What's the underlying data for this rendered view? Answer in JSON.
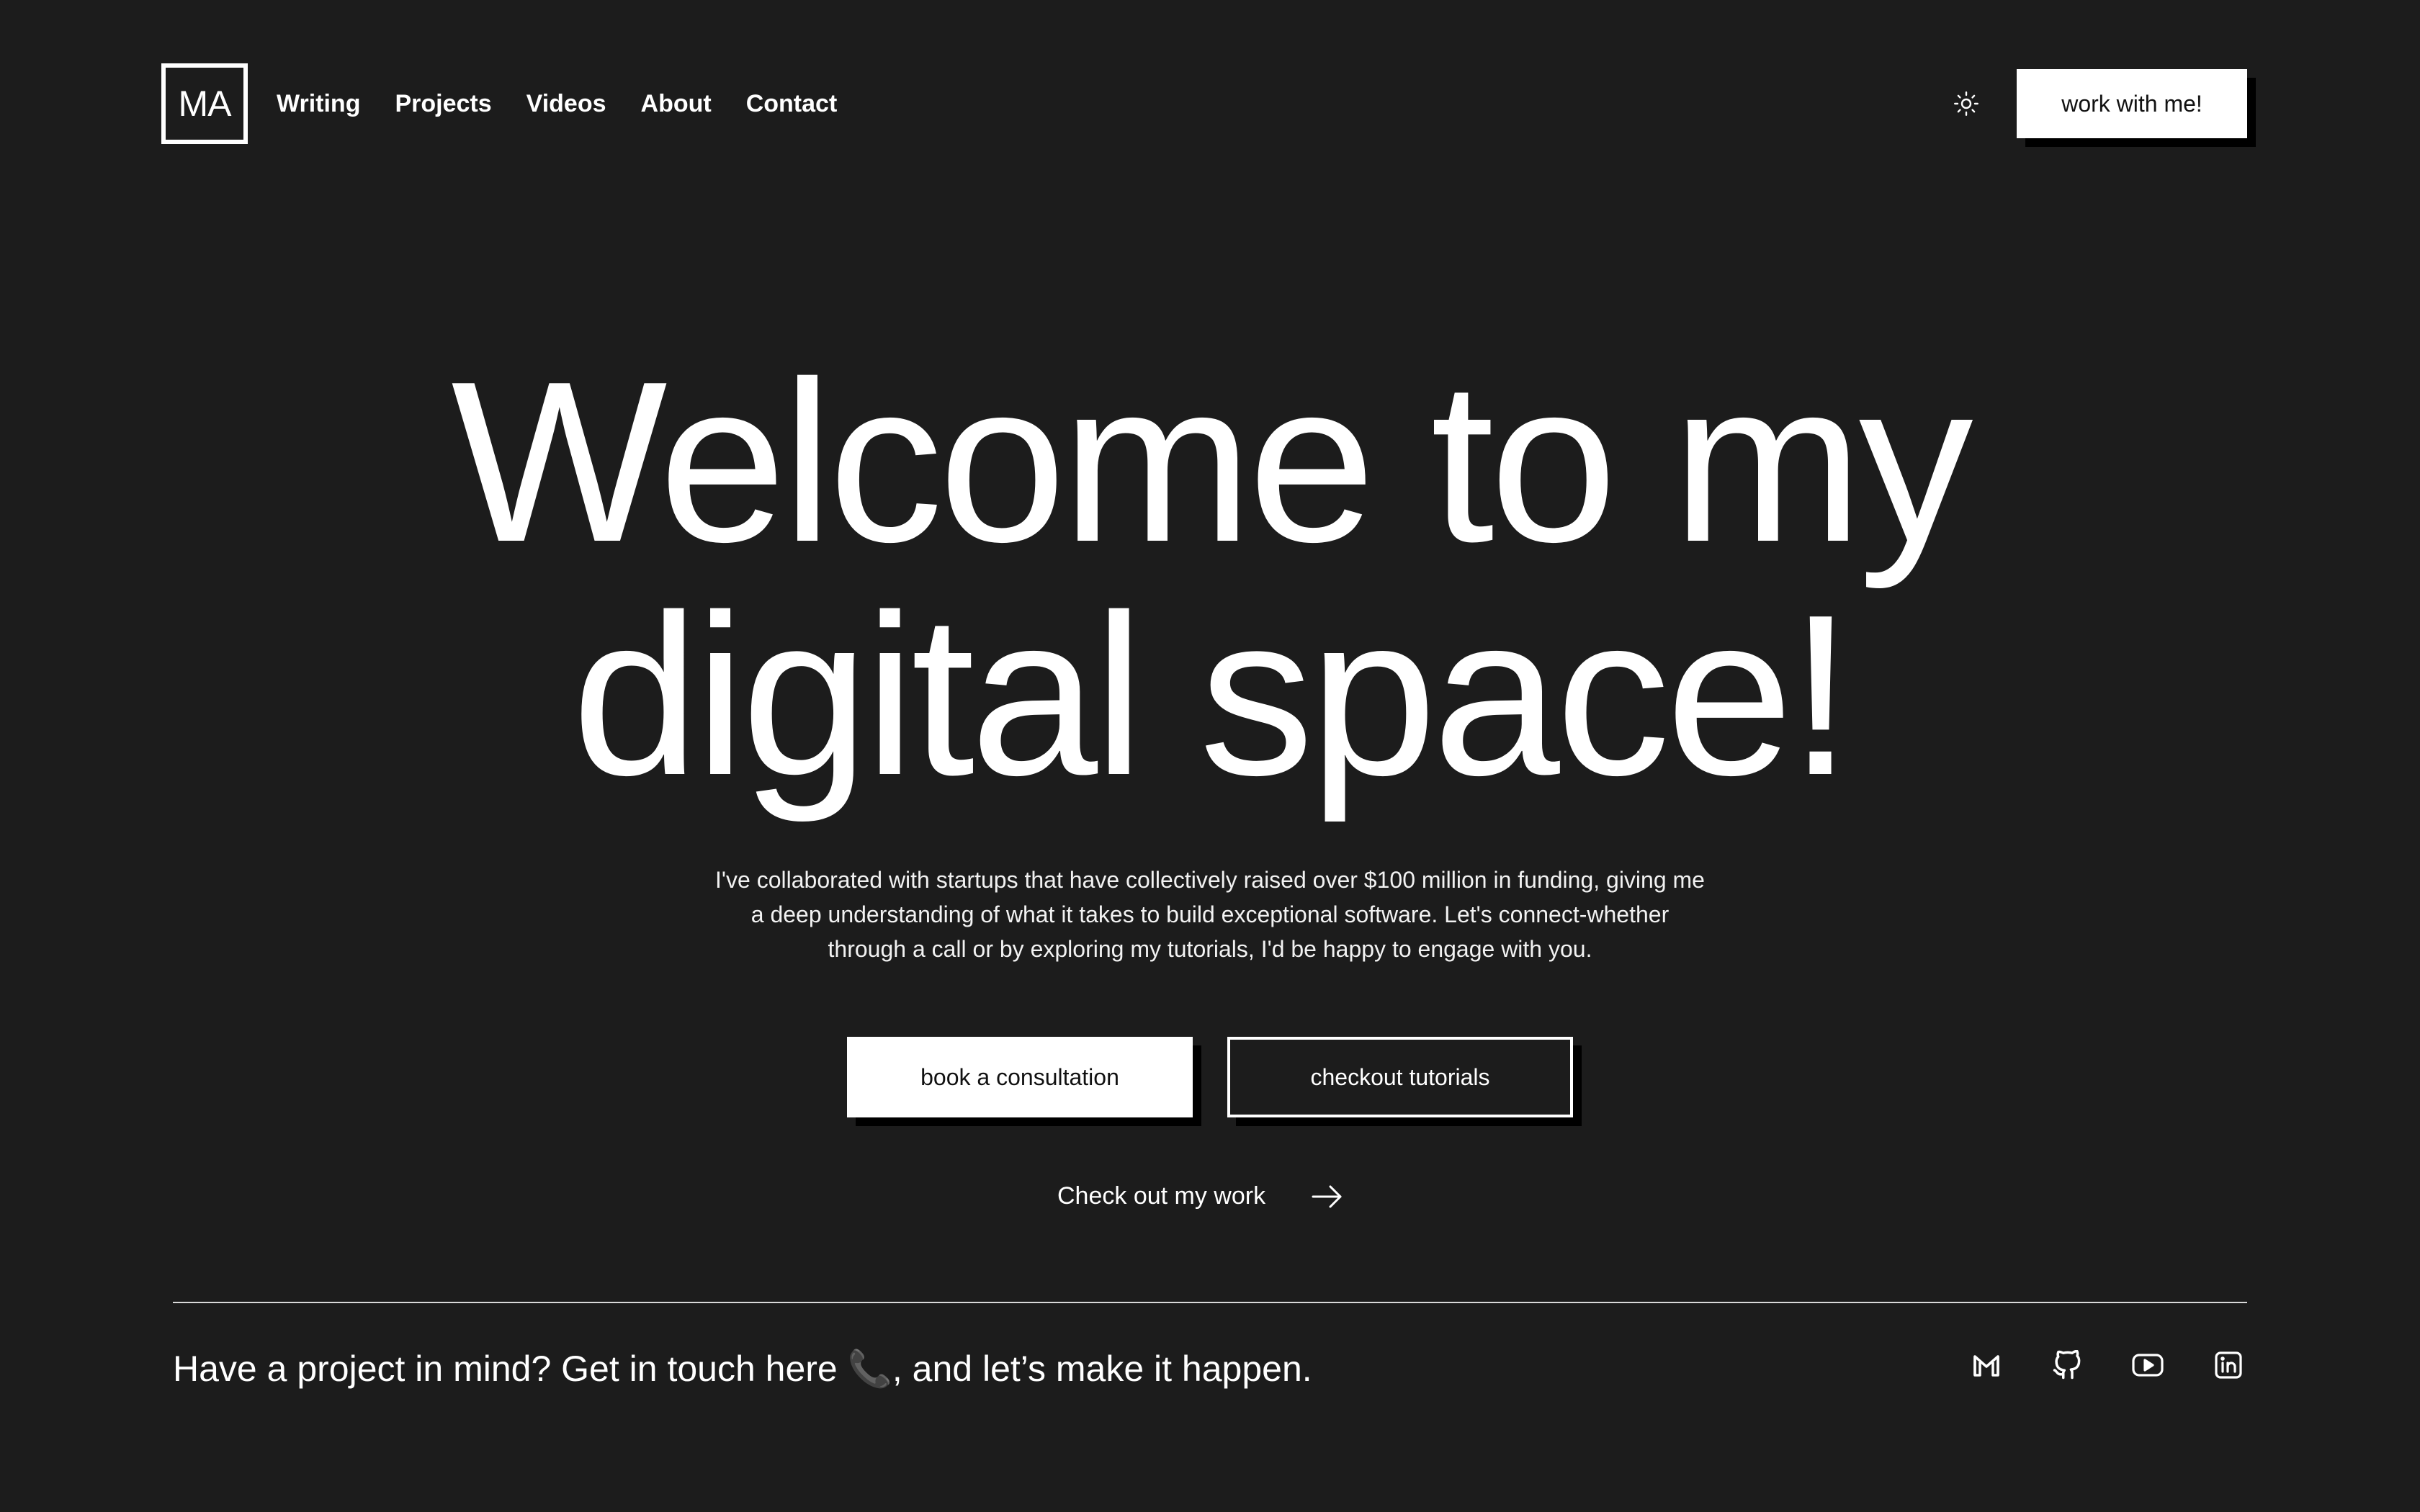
{
  "logo": {
    "text": "MA"
  },
  "nav": {
    "items": [
      {
        "label": "Writing"
      },
      {
        "label": "Projects"
      },
      {
        "label": "Videos"
      },
      {
        "label": "About"
      },
      {
        "label": "Contact"
      }
    ]
  },
  "header": {
    "theme_toggle_icon": "sun-icon",
    "cta_label": "work with me!"
  },
  "hero": {
    "title_line1": "Welcome to my",
    "title_line2": "digital space!",
    "subtitle_line1": "I've collaborated with startups that have collectively raised over $100 million in funding, giving me",
    "subtitle_line2": "a deep understanding of what it takes to build exceptional software. Let's connect-whether",
    "subtitle_line3": "through a call or by exploring my tutorials, I'd be happy to engage with you.",
    "primary_button": "book a consultation",
    "secondary_button": "checkout tutorials",
    "work_link": "Check out my work",
    "work_link_icon": "arrow-right-icon"
  },
  "footer": {
    "text": "Have a project in mind? Get in touch here 📞, and let’s make it happen.",
    "socials": [
      {
        "icon": "gmail-icon"
      },
      {
        "icon": "github-icon"
      },
      {
        "icon": "youtube-icon"
      },
      {
        "icon": "linkedin-icon"
      }
    ]
  },
  "colors": {
    "background": "#1c1c1c",
    "foreground": "#ffffff",
    "button_fill": "#ffffff",
    "button_shadow": "#000000"
  }
}
